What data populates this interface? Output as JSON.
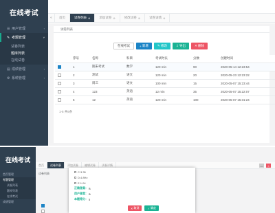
{
  "app": {
    "title": "在线考试"
  },
  "sidebar": {
    "items": [
      {
        "label": "用户管理",
        "icon": "user-icon"
      },
      {
        "label": "考题管理",
        "icon": "edit-icon",
        "active": true
      },
      {
        "label": "成绩管理",
        "icon": "chart-icon"
      },
      {
        "label": "系统管理",
        "icon": "gear-icon"
      }
    ],
    "submenu": [
      "试卷列表",
      "题库列表",
      "在线试卷"
    ]
  },
  "tabs": {
    "prev": "«",
    "next": "»",
    "items": [
      {
        "label": "首页"
      },
      {
        "label": "试卷列表",
        "active": true
      },
      {
        "label": "添加试卷"
      },
      {
        "label": "修改试卷"
      },
      {
        "label": "试卷详情"
      }
    ]
  },
  "panel": {
    "title": "试卷列表"
  },
  "toolbar": {
    "search": "在线考试",
    "add": "新增",
    "edit": "修改",
    "export": "导出",
    "delete": "删除"
  },
  "table": {
    "headers": [
      "",
      "序号",
      "名称",
      "科目",
      "考试时长",
      "分数",
      "创建时间"
    ],
    "rows": [
      {
        "checked": true,
        "cells": [
          "1",
          "期末考试",
          "数学",
          "120 min",
          "90",
          "2020-05-14 12:23:54"
        ]
      },
      {
        "checked": false,
        "cells": [
          "2",
          "测试",
          "语文",
          "120 min",
          "20",
          "2020-05-23 12:23:22"
        ]
      },
      {
        "checked": false,
        "cells": [
          "3",
          "周三",
          "语文",
          "100 min",
          "15",
          "2020-05-07 15:23:44"
        ]
      },
      {
        "checked": false,
        "cells": [
          "4",
          "123",
          "英语",
          "12 min",
          "35",
          "2020-05-07 15:22:07"
        ]
      },
      {
        "checked": false,
        "cells": [
          "5",
          "12",
          "英语",
          "120 min",
          "100",
          "2020-05-07 15:31:24"
        ]
      }
    ]
  },
  "pager": "1-5 共5条",
  "bottom": {
    "brand": "在线考试",
    "sidebar": [
      "首页管理",
      "考题管理",
      "试卷列表",
      "题库列表",
      "在线考试",
      "成绩管理"
    ],
    "tabs": [
      "首页",
      "试卷列表",
      "添加试卷",
      "编辑试卷",
      "试卷详情"
    ],
    "panel_title": "试卷列表",
    "ctrl_close": "×",
    "ctrl_min": "—",
    "dialog": {
      "options": [
        "C.3.35",
        "D.4.8Hz",
        "E.1.04"
      ],
      "lines": [
        {
          "label": "正确答案：",
          "value": "B"
        },
        {
          "label": "用户答案：",
          "value": "B"
        },
        {
          "label": "本题得分：",
          "value": "5"
        }
      ],
      "cancel": "取消",
      "confirm": "确定"
    }
  }
}
